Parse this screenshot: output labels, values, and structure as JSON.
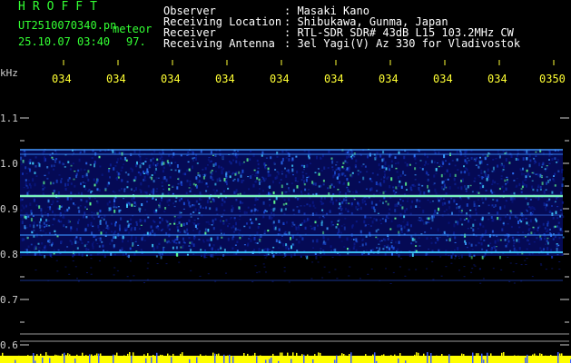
{
  "app": {
    "title": "HROFFT"
  },
  "file": {
    "name": "UT2510070340.pn",
    "tag": "meteor",
    "datetime": "25.10.07 03:40",
    "count": "97."
  },
  "info": [
    {
      "label": "Observer",
      "value": ": Masaki Kano"
    },
    {
      "label": "Receiving Location",
      "value": ": Shibukawa, Gunma, Japan"
    },
    {
      "label": "Receiver",
      "value": ": RTL-SDR SDR# 43dB L15 103.2MHz CW"
    },
    {
      "label": "Receiving Antenna",
      "value": ": 3el Yagi(V) Az 330 for Vladivostok"
    }
  ],
  "axis": {
    "unit": "kHz",
    "y_ticks": [
      "1.1",
      "1.0",
      "0.9",
      "0.8",
      "0.7",
      "0.6"
    ],
    "time_ticks": [
      "034",
      "034",
      "034",
      "034",
      "034",
      "034",
      "034",
      "034",
      "034",
      "0350"
    ]
  },
  "colors": {
    "text_green": "#33ff33",
    "tick_yellow": "#ffff33",
    "background": "#000000"
  }
}
